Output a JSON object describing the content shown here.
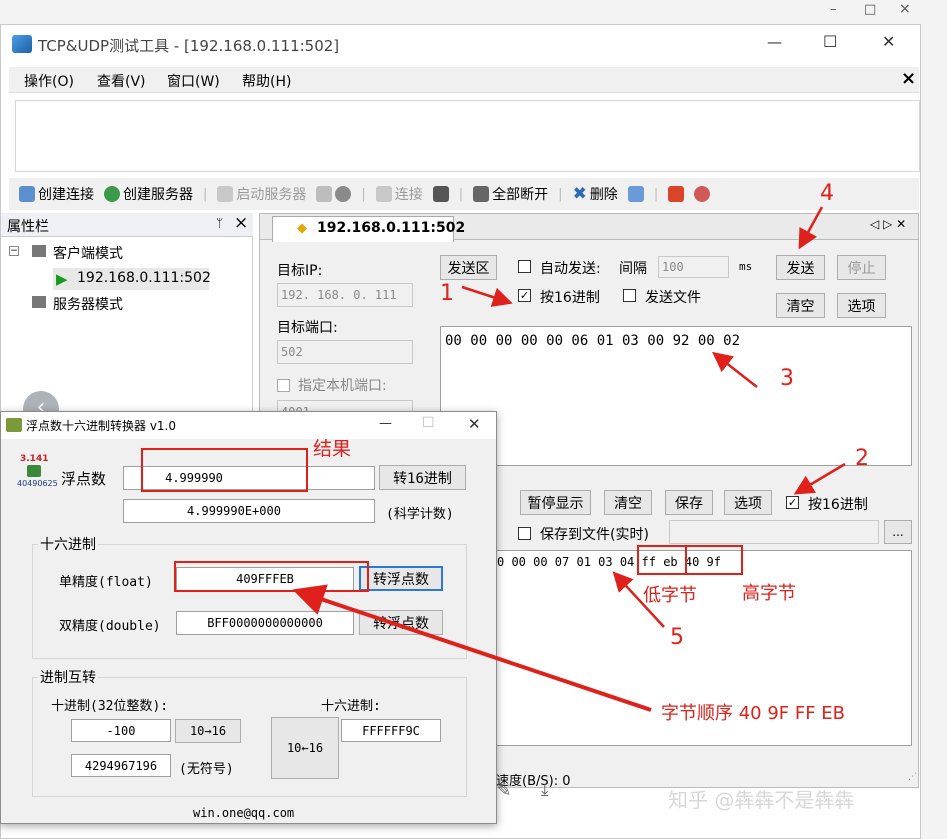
{
  "outer": {
    "min": "–",
    "max": "□",
    "close": "×"
  },
  "app": {
    "title": "TCP&UDP测试工具 - [192.168.0.111:502]",
    "win_min": "—",
    "win_max": "☐",
    "win_close": "✕",
    "menu": [
      "操作(O)",
      "查看(V)",
      "窗口(W)",
      "帮助(H)"
    ],
    "menu_close": "×",
    "toolbar": [
      {
        "label": "创建连接",
        "enabled": true
      },
      {
        "label": "创建服务器",
        "enabled": true
      },
      {
        "label": "启动服务器",
        "enabled": false
      },
      {
        "label": "",
        "enabled": false
      },
      {
        "label": "连接",
        "enabled": false
      },
      {
        "label": "",
        "enabled": true
      },
      {
        "label": "全部断开",
        "enabled": true
      },
      {
        "label": "删除",
        "enabled": true
      }
    ],
    "sidebar": {
      "title": "属性栏",
      "pin": "ᛘ",
      "close": "×",
      "client_mode": "客户端模式",
      "connection": "192.168.0.111:502",
      "server_mode": "服务器模式"
    },
    "tab": {
      "label": "192.168.0.111:502",
      "nav": "◁ ▷ ✕"
    },
    "target_ip_label": "目标IP:",
    "target_ip_value": "192. 168. 0. 111",
    "target_port_label": "目标端口:",
    "target_port_value": "502",
    "local_port_label": "指定本机端口:",
    "local_port_value": "4001",
    "send_area_label": "发送区",
    "auto_send_label": "自动发送:",
    "interval_label": "间隔",
    "interval_value": "100",
    "interval_unit": "ms",
    "send_button": "发送",
    "stop_button": "停止",
    "hex_send_label": "按16进制",
    "send_file_label": "发送文件",
    "clear_button": "清空",
    "options_button": "选项",
    "send_content": "00 00 00 00 00 06 01 03 00 92 00 02",
    "pause_button": "暂停显示",
    "clear_recv_button": "清空",
    "save_button": "保存",
    "recv_options_button": "选项",
    "hex_recv_label": "按16进制",
    "save_file_label": "保存到文件(实时)",
    "browse_button": "...",
    "recv_prefix": "0 00 00 07 01 03 04",
    "recv_low": "ff eb",
    "recv_high": "40 9f",
    "status_speed": "速度(B/S): 0"
  },
  "converter": {
    "title": "浮点数十六进制转换器 v1.0",
    "logo_top": "3.141",
    "logo_bottom": "40490625",
    "float_label": "浮点数",
    "float_value": "4.999990",
    "to_hex_button": "转16进制",
    "sci_value": "4.999990E+000",
    "sci_label": "(科学计数)",
    "hex_group": "十六进制",
    "single_label": "单精度(float)",
    "single_value": "409FFFEB",
    "to_float_button": "转浮点数",
    "double_label": "双精度(double)",
    "double_value": "BFF0000000000000",
    "to_float_button2": "转浮点数",
    "radix_group": "进制互转",
    "dec_label": "十进制(32位整数):",
    "hex_label": "十六进制:",
    "dec_value": "-100",
    "dec_to_hex": "10→16",
    "hex_to_dec": "10←16",
    "hex_value": "FFFFFF9C",
    "unsigned_value": "4294967196",
    "unsigned_label": "(无符号)",
    "email": "win.one@qq.com",
    "min": "—",
    "max": "☐",
    "close": "✕"
  },
  "annotations": {
    "n1": "1",
    "n2": "2",
    "n3": "3",
    "n4": "4",
    "n5": "5",
    "result": "结果",
    "low_byte": "低字节",
    "high_byte": "高字节",
    "byte_order": "字节顺序  40 9F FF EB"
  },
  "watermark": "知乎 @犇犇不是犇犇",
  "colors": {
    "annotation": "#e0201a",
    "accent": "#2a6ab8"
  }
}
